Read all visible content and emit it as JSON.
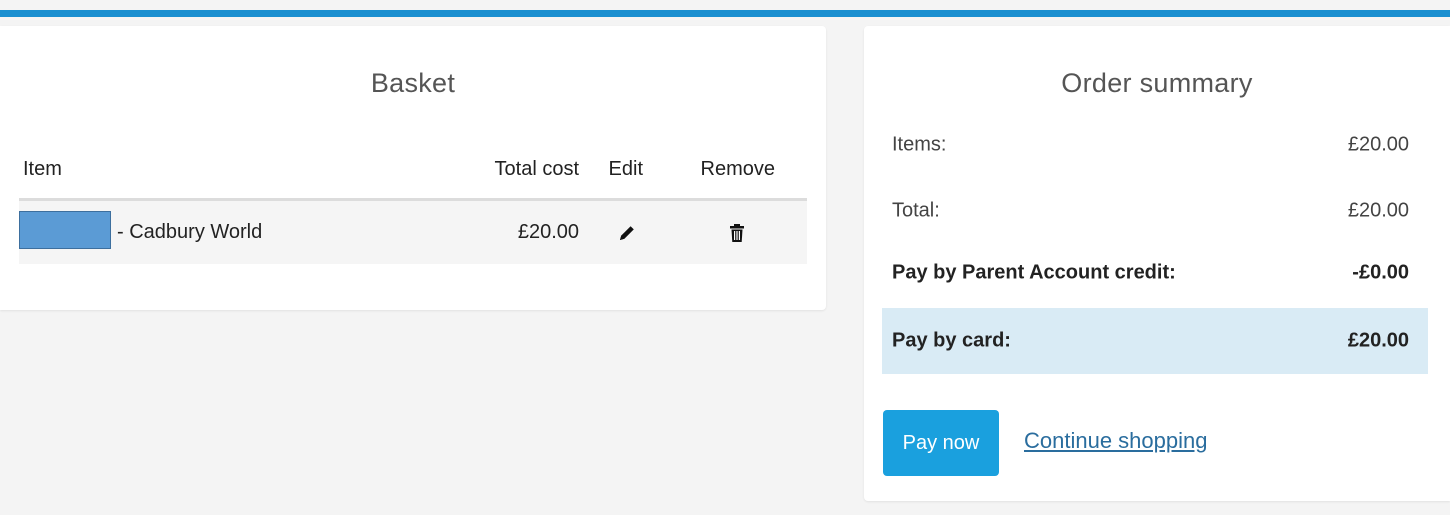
{
  "colors": {
    "accent": "#1a8fd0",
    "button": "#1aa0de",
    "highlight_row": "#d9ebf5",
    "link": "#2a6d9e"
  },
  "basket": {
    "title": "Basket",
    "columns": {
      "item": "Item",
      "total_cost": "Total cost",
      "edit": "Edit",
      "remove": "Remove"
    },
    "rows": [
      {
        "item": "- Cadbury World",
        "total_cost": "£20.00",
        "edit_icon": "pencil-icon",
        "remove_icon": "trash-icon"
      }
    ]
  },
  "summary": {
    "title": "Order summary",
    "items_label": "Items:",
    "items_value": "£20.00",
    "total_label": "Total:",
    "total_value": "£20.00",
    "credit_label": "Pay by Parent Account credit:",
    "credit_value": "-£0.00",
    "card_label": "Pay by card:",
    "card_value": "£20.00",
    "pay_button": "Pay now",
    "continue_link": "Continue shopping"
  }
}
